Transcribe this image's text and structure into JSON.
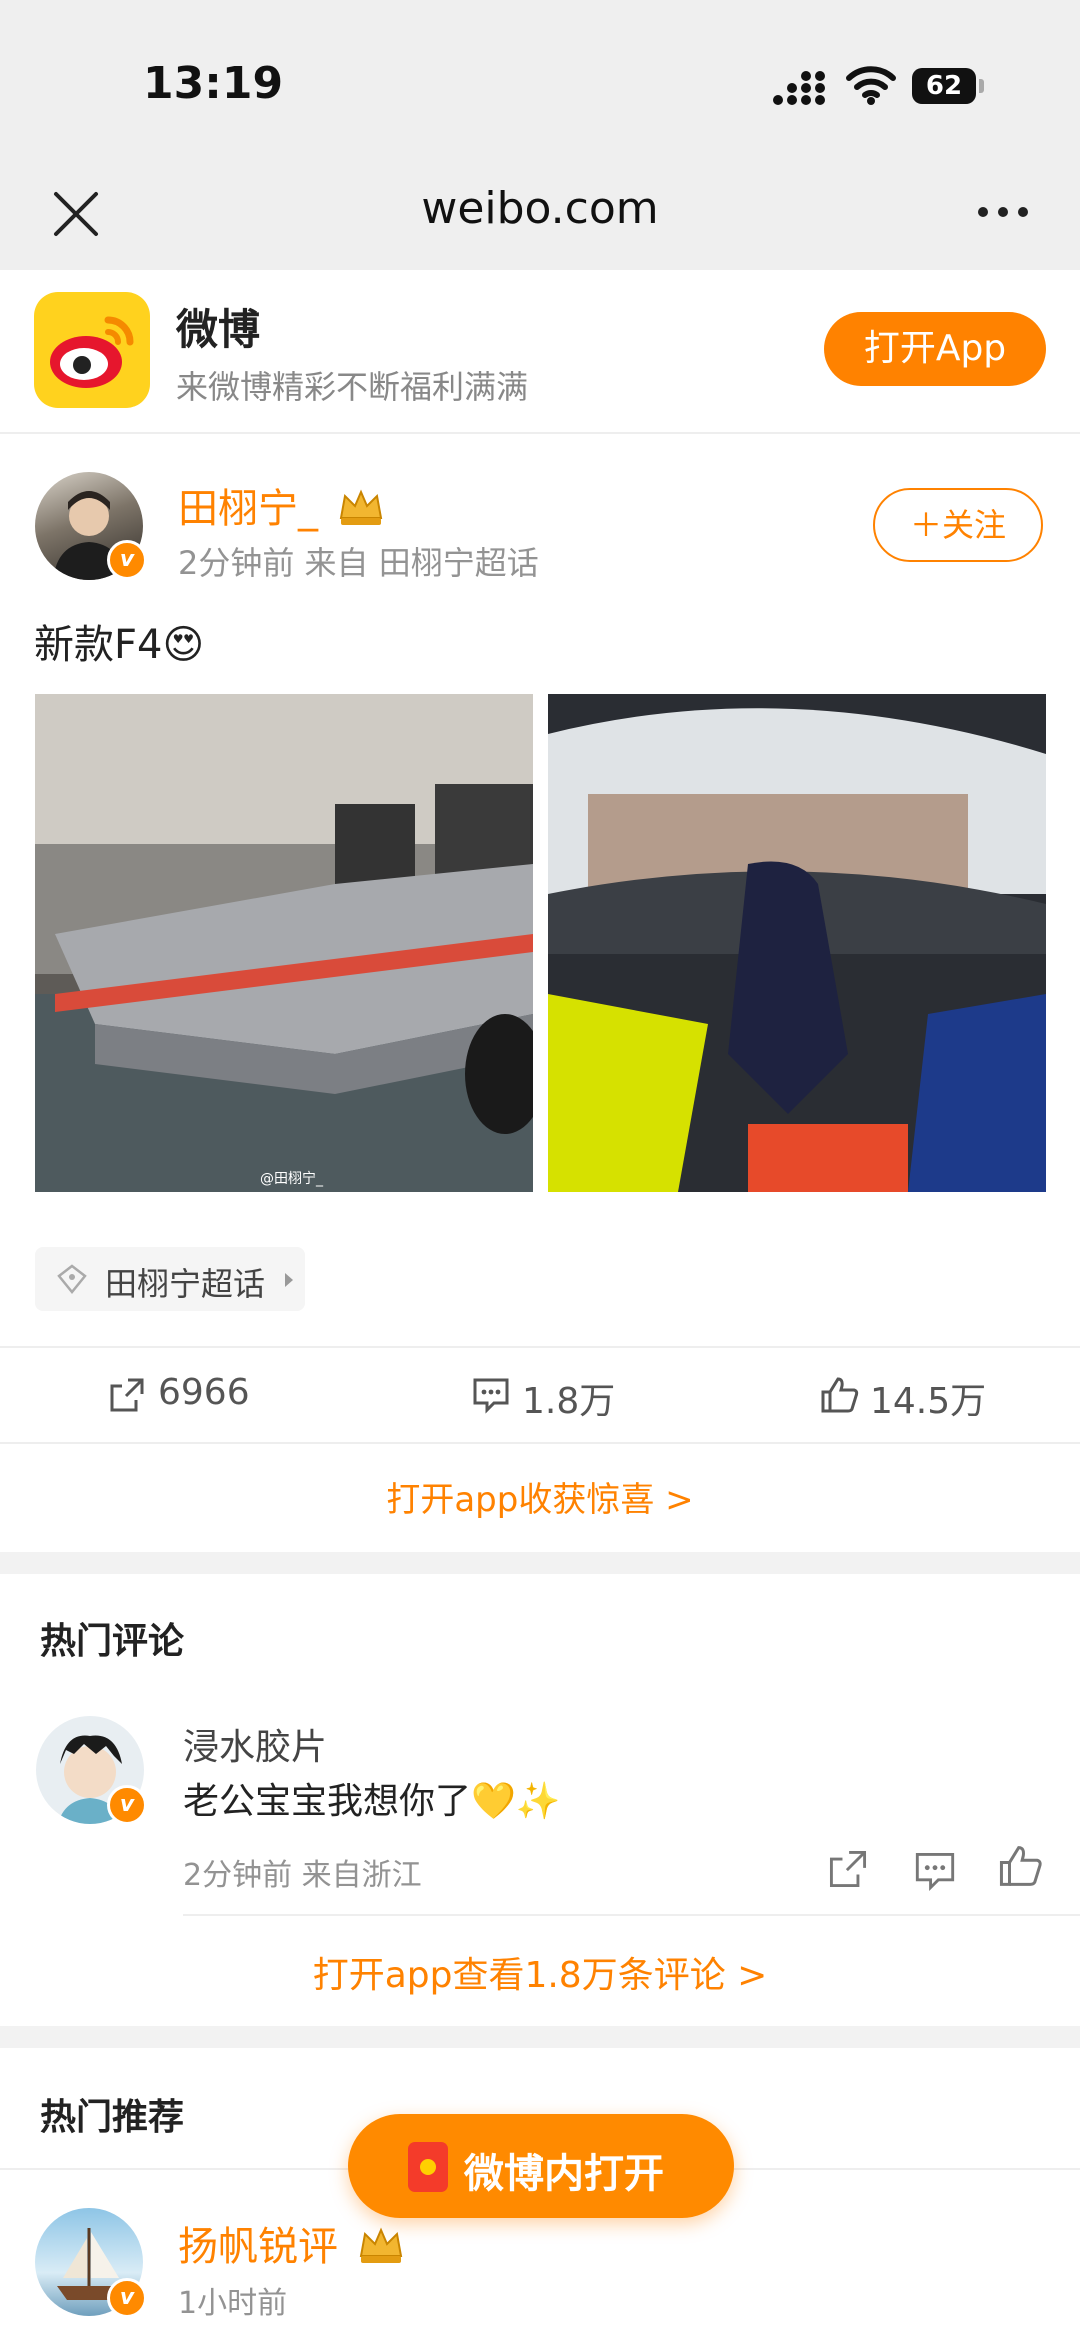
{
  "status_bar": {
    "time": "13:19",
    "battery": "62"
  },
  "browser": {
    "url": "weibo.com"
  },
  "app_banner": {
    "name": "微博",
    "slogan": "来微博精彩不断福利满满",
    "open_button": "打开App"
  },
  "post": {
    "author": "田栩宁_",
    "meta": "2分钟前  来自 田栩宁超话",
    "follow_button": "关注",
    "text": "新款F4😍",
    "image_watermark": "@田栩宁_",
    "topic_tag": "田栩宁超话",
    "actions": {
      "reposts": "6966",
      "comments": "1.8万",
      "likes": "14.5万"
    },
    "open_app_link": "打开app收获惊喜 >"
  },
  "hot_comments": {
    "title": "热门评论",
    "items": [
      {
        "user": "浸水胶片",
        "text": "老公宝宝我想你了💛✨",
        "meta": "2分钟前 来自浙江"
      }
    ],
    "more_link": "打开app查看1.8万条评论 >"
  },
  "recommendations": {
    "title": "热门推荐",
    "items": [
      {
        "author": "扬帆锐评",
        "meta": "1小时前"
      }
    ]
  },
  "floating_button": {
    "label": "微博内打开"
  },
  "colors": {
    "accent": "#ff8200",
    "banner_bg": "#efefef",
    "divider": "#f2f2f2"
  }
}
